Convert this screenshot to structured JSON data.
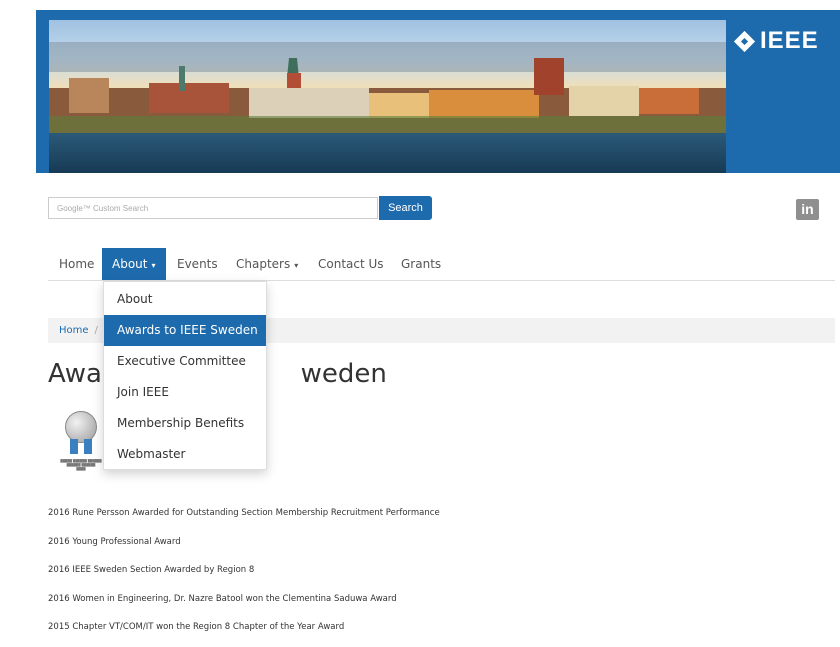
{
  "header": {
    "logo_text": "IEEE"
  },
  "search": {
    "placeholder": "Google™ Custom Search",
    "button_label": "Search"
  },
  "social": {
    "linkedin_label": "in"
  },
  "nav": {
    "items": [
      {
        "label": "Home"
      },
      {
        "label": "About"
      },
      {
        "label": "Events"
      },
      {
        "label": "Chapters"
      },
      {
        "label": "Contact Us"
      },
      {
        "label": "Grants"
      }
    ]
  },
  "dropdown": {
    "items": [
      {
        "label": "About"
      },
      {
        "label": "Awards to IEEE Sweden"
      },
      {
        "label": "Executive Committee"
      },
      {
        "label": "Join IEEE"
      },
      {
        "label": "Membership Benefits"
      },
      {
        "label": "Webmaster"
      }
    ]
  },
  "breadcrumb": {
    "home": "Home",
    "separator": "/"
  },
  "page": {
    "title_left": "Awar",
    "title_right": "weden"
  },
  "awards": {
    "items": [
      "2016 Rune Persson Awarded for Outstanding Section Membership Recruitment Performance",
      "2016 Young Professional Award",
      "2016 IEEE Sweden Section Awarded by Region 8",
      "2016 Women in Engineering, Dr. Nazre Batool won the Clementina Saduwa Award",
      "2015 Chapter VT/COM/IT won the Region 8 Chapter of the Year Award"
    ]
  },
  "colors": {
    "brand_blue": "#1d6bad"
  }
}
